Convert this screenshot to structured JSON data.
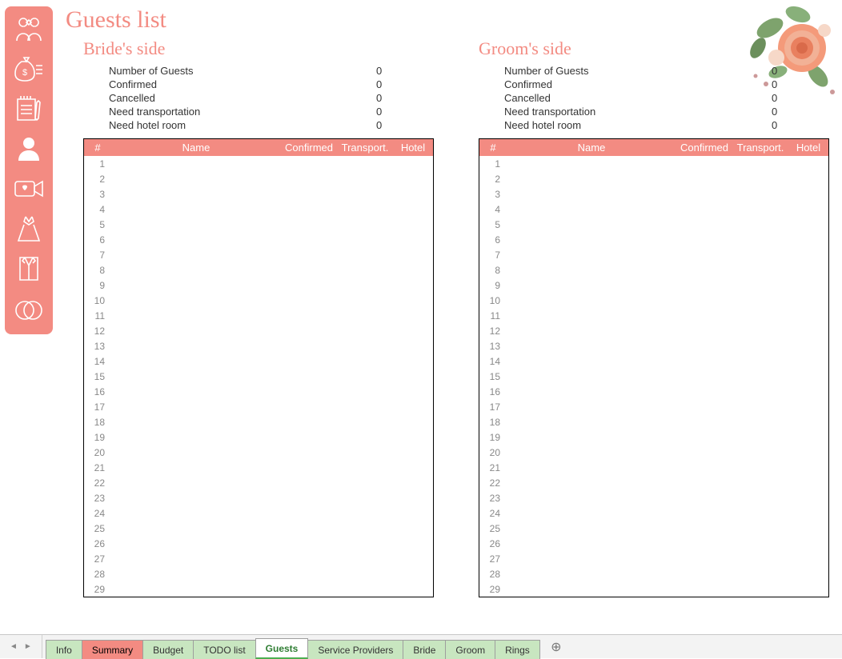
{
  "page": {
    "title": "Guests list"
  },
  "nav": {
    "items": [
      {
        "name": "couple-icon"
      },
      {
        "name": "money-bag-icon"
      },
      {
        "name": "todo-list-icon"
      },
      {
        "name": "guest-icon"
      },
      {
        "name": "video-heart-icon"
      },
      {
        "name": "dress-icon"
      },
      {
        "name": "suit-icon"
      },
      {
        "name": "rings-icon"
      }
    ]
  },
  "bride": {
    "title": "Bride's side",
    "stats": {
      "guests_label": "Number of Guests",
      "guests": "0",
      "confirmed_label": "Confirmed",
      "confirmed": "0",
      "cancelled_label": "Cancelled",
      "cancelled": "0",
      "transport_label": "Need transportation",
      "transport": "0",
      "hotel_label": "Need hotel room",
      "hotel": "0"
    },
    "headers": {
      "num": "#",
      "name": "Name",
      "confirmed": "Confirmed",
      "transport": "Transport.",
      "hotel": "Hotel"
    },
    "rows": [
      1,
      2,
      3,
      4,
      5,
      6,
      7,
      8,
      9,
      10,
      11,
      12,
      13,
      14,
      15,
      16,
      17,
      18,
      19,
      20,
      21,
      22,
      23,
      24,
      25,
      26,
      27,
      28,
      29
    ]
  },
  "groom": {
    "title": "Groom's side",
    "stats": {
      "guests_label": "Number of Guests",
      "guests": "0",
      "confirmed_label": "Confirmed",
      "confirmed": "0",
      "cancelled_label": "Cancelled",
      "cancelled": "0",
      "transport_label": "Need transportation",
      "transport": "0",
      "hotel_label": "Need hotel room",
      "hotel": "0"
    },
    "headers": {
      "num": "#",
      "name": "Name",
      "confirmed": "Confirmed",
      "transport": "Transport.",
      "hotel": "Hotel"
    },
    "rows": [
      1,
      2,
      3,
      4,
      5,
      6,
      7,
      8,
      9,
      10,
      11,
      12,
      13,
      14,
      15,
      16,
      17,
      18,
      19,
      20,
      21,
      22,
      23,
      24,
      25,
      26,
      27,
      28,
      29
    ]
  },
  "sheets": {
    "tabs": [
      {
        "label": "Info",
        "style": "normal"
      },
      {
        "label": "Summary",
        "style": "summary"
      },
      {
        "label": "Budget",
        "style": "normal"
      },
      {
        "label": "TODO list",
        "style": "normal"
      },
      {
        "label": "Guests",
        "style": "active"
      },
      {
        "label": "Service Providers",
        "style": "normal"
      },
      {
        "label": "Bride",
        "style": "normal"
      },
      {
        "label": "Groom",
        "style": "normal"
      },
      {
        "label": "Rings",
        "style": "normal"
      }
    ]
  }
}
